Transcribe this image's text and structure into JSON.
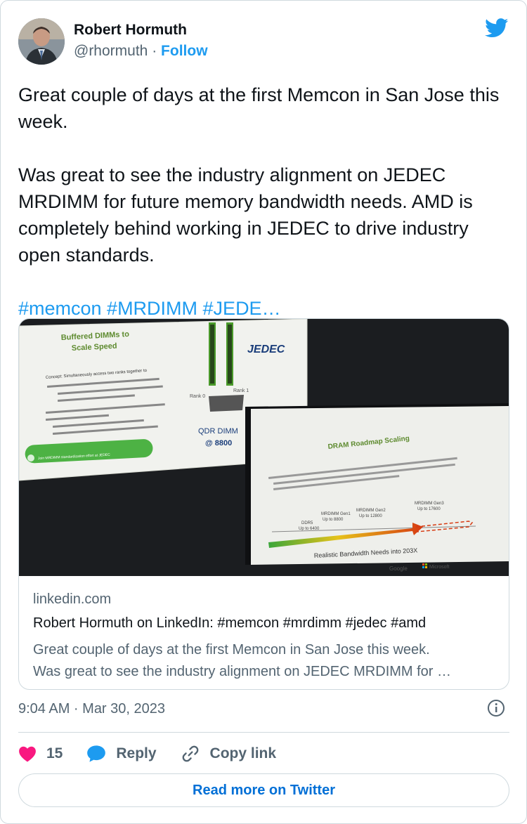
{
  "author": {
    "name": "Robert Hormuth",
    "handle": "@rhormuth",
    "separator": "·",
    "follow_label": "Follow"
  },
  "tweet": {
    "paragraph1": "Great couple of days at the first Memcon in San Jose this week.",
    "paragraph2": "Was great to see the industry alignment on JEDEC MRDIMM for future memory bandwidth needs. AMD is completely behind working in JEDEC to drive industry open standards.",
    "hashtags": "#memcon #MRDIMM #JEDE…"
  },
  "link_card": {
    "image_alt": "Slides: Buffered DIMMs to Scale Speed; DRAM Roadmap Scaling",
    "slide1": {
      "title1": "Buffered DIMMs to",
      "title2": "Scale Speed",
      "logo": "JEDEC",
      "concept": "Concept: Simultaneously access two ranks together to",
      "rank0": "Rank 0",
      "rank1": "Rank 1",
      "qdr1": "QDR DIMM",
      "qdr2": "@ 8800",
      "join": "Join MRDIMM standardization effort at JEDEC"
    },
    "slide2": {
      "title": "DRAM Roadmap Scaling",
      "ddr5_a": "DDR5",
      "ddr5_a_val": "Up to 6400",
      "ddr5_b": "MRDIMM Gen1",
      "ddr5_b_val": "Up to 8800",
      "ddr5_c": "MRDIMM Gen2",
      "ddr5_c_val": "Up to 12800",
      "ddr5_d": "MRDIMM Gen3",
      "ddr5_d_val": "Up to 17600",
      "bandwidth": "Realistic Bandwidth Needs into 203X",
      "google": "Google",
      "microsoft": "Microsoft"
    },
    "domain": "linkedin.com",
    "title": "Robert Hormuth on LinkedIn: #memcon #mrdimm #jedec #amd",
    "desc_line1": "Great couple of days at the first Memcon in San Jose this week.",
    "desc_line2": "Was great to see the industry alignment on JEDEC MRDIMM for …"
  },
  "timestamp": "9:04 AM · Mar 30, 2023",
  "actions": {
    "like_count": "15",
    "reply_label": "Reply",
    "copy_label": "Copy link"
  },
  "read_more_label": "Read more on Twitter",
  "colors": {
    "accent": "#1d9bf0",
    "like": "#f91880",
    "text": "#0f1419",
    "muted": "#536471",
    "border": "#cfd9de"
  },
  "icons": [
    "twitter-bird-icon",
    "info-icon",
    "heart-icon",
    "reply-icon",
    "link-icon"
  ]
}
